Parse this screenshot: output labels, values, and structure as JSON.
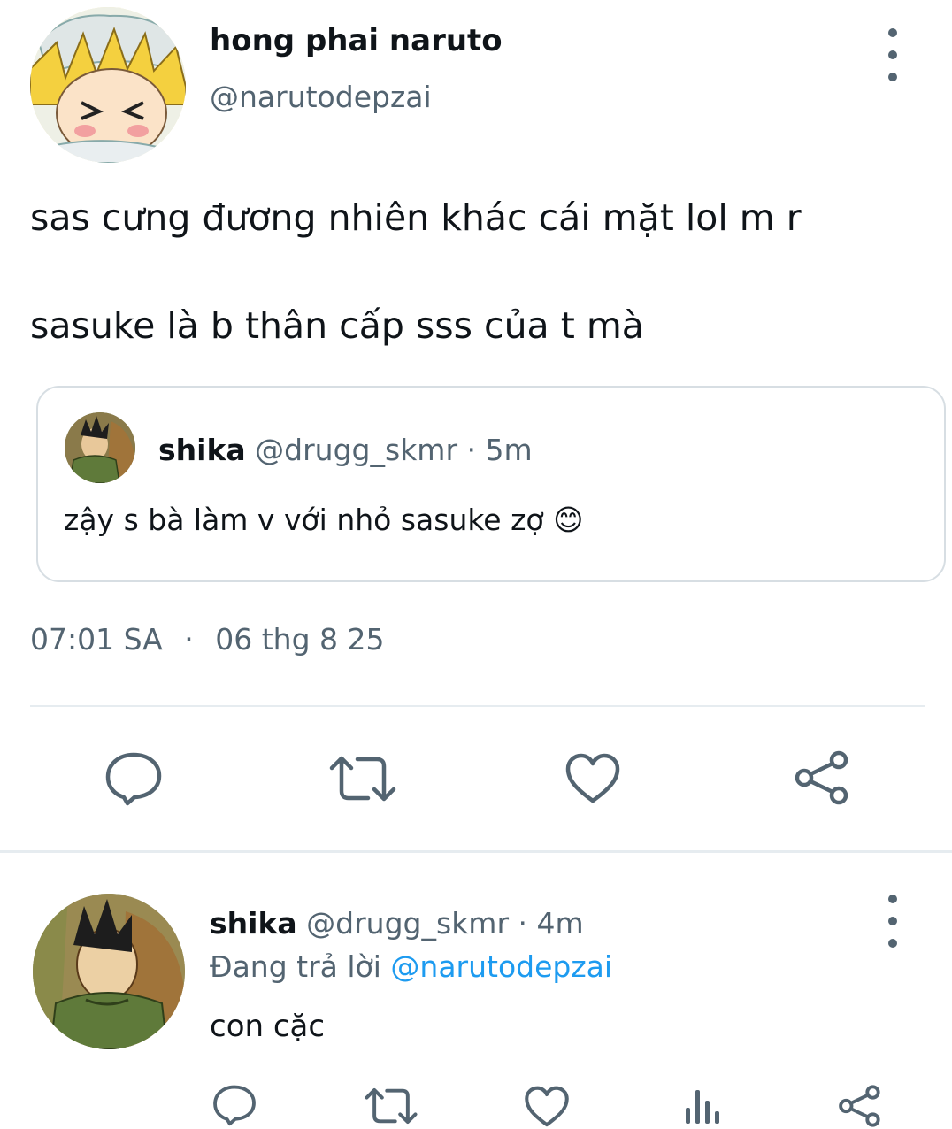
{
  "tweet": {
    "author": {
      "display_name": "hong phai naruto",
      "handle": "@narutodepzai",
      "avatar_icon": "naruto-avatar"
    },
    "text_line_1": "sas cưng đương nhiên khác cái mặt lol m r",
    "text_line_2": "sasuke là b thân cấp sss của t mà",
    "quote": {
      "display_name": "shika",
      "handle": "@drugg_skmr",
      "separator": "·",
      "time": "5m",
      "text": "zậy s bà làm v với nhỏ sasuke zợ",
      "emoji": "😊",
      "avatar_icon": "shikamaru-avatar"
    },
    "time": "07:01 SA",
    "dot": "·",
    "date": "06 thg 8 25",
    "actions": [
      "reply-icon",
      "retweet-icon",
      "like-icon",
      "share-icon"
    ]
  },
  "reply": {
    "author": {
      "display_name": "shika",
      "handle": "@drugg_skmr",
      "separator": "·",
      "time": "4m",
      "avatar_icon": "shikamaru-avatar"
    },
    "replying_to_label": "Đang trả lời",
    "replying_to_handle": "@narutodepzai",
    "text": "con cặc",
    "actions": [
      "reply-icon",
      "retweet-icon",
      "like-icon",
      "views-icon",
      "share-icon"
    ]
  },
  "colors": {
    "text": "#0f1419",
    "muted": "#536471",
    "link": "#1d9bf0",
    "divider": "#e6ecf0"
  }
}
